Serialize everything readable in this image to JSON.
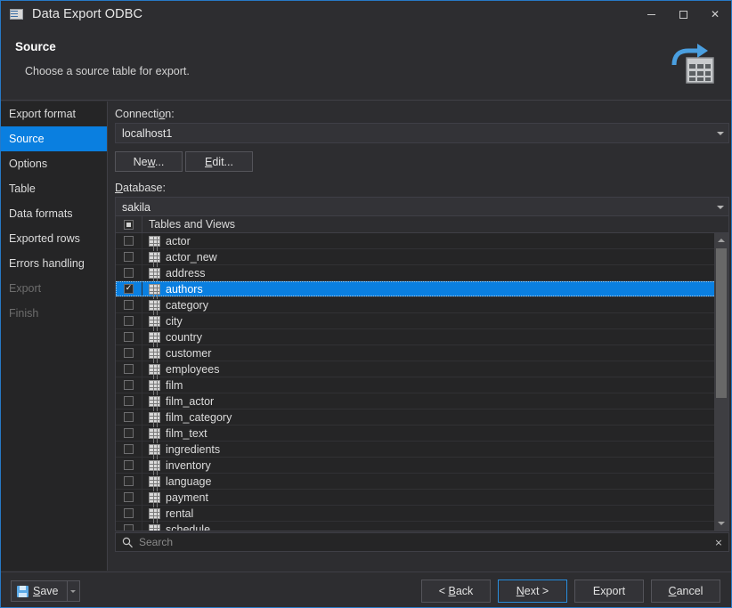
{
  "window": {
    "title": "Data Export ODBC",
    "icon": "app-grid-icon",
    "controls": {
      "minimize": "minimize",
      "maximize": "maximize",
      "close": "close"
    }
  },
  "header": {
    "title": "Source",
    "subtitle": "Choose a source table for export.",
    "icon": "export-table-icon",
    "icon_accent": "#4a9fe0"
  },
  "sidebar": {
    "items": [
      {
        "label": "Export format",
        "state": "enabled"
      },
      {
        "label": "Source",
        "state": "selected"
      },
      {
        "label": "Options",
        "state": "enabled"
      },
      {
        "label": "Table",
        "state": "enabled"
      },
      {
        "label": "Data formats",
        "state": "enabled"
      },
      {
        "label": "Exported rows",
        "state": "enabled"
      },
      {
        "label": "Errors handling",
        "state": "enabled"
      },
      {
        "label": "Export",
        "state": "disabled"
      },
      {
        "label": "Finish",
        "state": "disabled"
      }
    ],
    "selected_color": "#0a7fe0"
  },
  "main": {
    "connection_label": "Connection:",
    "connection_value": "localhost1",
    "new_button": "New...",
    "edit_button": "Edit...",
    "database_label": "Database:",
    "database_value": "sakila",
    "list_header": {
      "check_state": "partial",
      "title": "Tables and Views"
    },
    "tables": [
      {
        "name": "actor",
        "checked": false,
        "selected": false
      },
      {
        "name": "actor_new",
        "checked": false,
        "selected": false
      },
      {
        "name": "address",
        "checked": false,
        "selected": false
      },
      {
        "name": "authors",
        "checked": true,
        "selected": true
      },
      {
        "name": "category",
        "checked": false,
        "selected": false
      },
      {
        "name": "city",
        "checked": false,
        "selected": false
      },
      {
        "name": "country",
        "checked": false,
        "selected": false
      },
      {
        "name": "customer",
        "checked": false,
        "selected": false
      },
      {
        "name": "employees",
        "checked": false,
        "selected": false
      },
      {
        "name": "film",
        "checked": false,
        "selected": false
      },
      {
        "name": "film_actor",
        "checked": false,
        "selected": false
      },
      {
        "name": "film_category",
        "checked": false,
        "selected": false
      },
      {
        "name": "film_text",
        "checked": false,
        "selected": false
      },
      {
        "name": "ingredients",
        "checked": false,
        "selected": false
      },
      {
        "name": "inventory",
        "checked": false,
        "selected": false
      },
      {
        "name": "language",
        "checked": false,
        "selected": false
      },
      {
        "name": "payment",
        "checked": false,
        "selected": false
      },
      {
        "name": "rental",
        "checked": false,
        "selected": false
      },
      {
        "name": "schedule",
        "checked": false,
        "selected": false
      }
    ],
    "search_placeholder": "Search",
    "search_value": "",
    "search_clear": "×"
  },
  "footer": {
    "save_label": "Save",
    "save_mnemonic": "S",
    "save_dropdown": "save-options",
    "buttons": [
      {
        "label": "< Back",
        "mnemonic": "B",
        "focused": false
      },
      {
        "label": "Next >",
        "mnemonic": "N",
        "focused": true
      },
      {
        "label": "Export",
        "mnemonic": "",
        "focused": false
      },
      {
        "label": "Cancel",
        "mnemonic": "C",
        "focused": false
      }
    ]
  }
}
